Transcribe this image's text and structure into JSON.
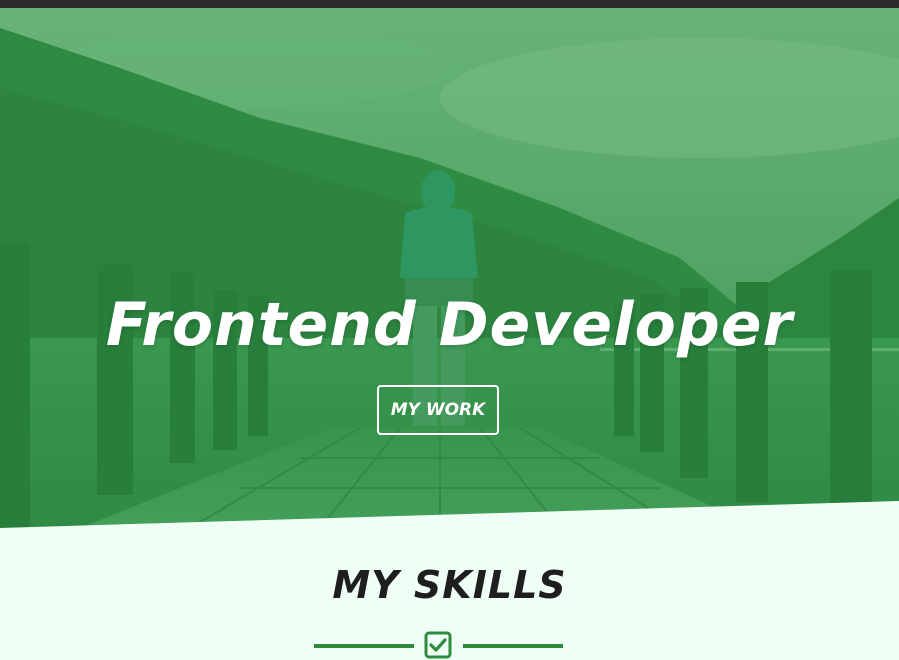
{
  "hero": {
    "title": "Frontend Developer",
    "button_label": "MY WORK",
    "overlay_color": "#2e8b3e"
  },
  "skills": {
    "title": "MY SKILLS",
    "divider_icon": "check-square-icon",
    "accent_color": "#2e8b3e"
  },
  "page": {
    "background_color": "#f0fff6",
    "topbar_color": "#2b2b2b"
  }
}
